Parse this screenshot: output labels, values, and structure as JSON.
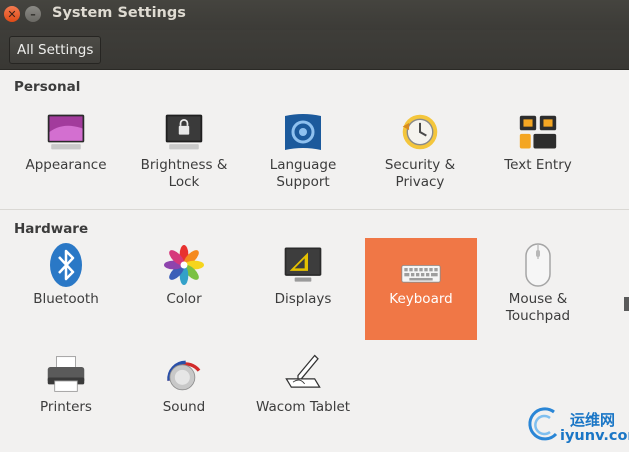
{
  "window": {
    "title": "System Settings"
  },
  "toolbar": {
    "all_settings": "All Settings"
  },
  "sections": {
    "personal": {
      "heading": "Personal",
      "items": [
        {
          "label": "Appearance",
          "icon": "appearance-icon"
        },
        {
          "label": "Brightness &\nLock",
          "icon": "brightness-lock-icon"
        },
        {
          "label": "Language\nSupport",
          "icon": "language-support-icon"
        },
        {
          "label": "Security &\nPrivacy",
          "icon": "security-privacy-icon"
        },
        {
          "label": "Text Entry",
          "icon": "text-entry-icon"
        }
      ]
    },
    "hardware": {
      "heading": "Hardware",
      "items": [
        {
          "label": "Bluetooth",
          "icon": "bluetooth-icon"
        },
        {
          "label": "Color",
          "icon": "color-icon"
        },
        {
          "label": "Displays",
          "icon": "displays-icon"
        },
        {
          "label": "Keyboard",
          "icon": "keyboard-icon",
          "selected": true
        },
        {
          "label": "Mouse &\nTouchpad",
          "icon": "mouse-icon"
        },
        {
          "label": "Printers",
          "icon": "printer-icon"
        },
        {
          "label": "Sound",
          "icon": "sound-icon"
        },
        {
          "label": "Wacom Tablet",
          "icon": "wacom-tablet-icon"
        }
      ]
    }
  },
  "watermark": {
    "cn": "运维网",
    "en": "iyunv.com"
  },
  "colors": {
    "selected": "#f07746",
    "titlebar": "#3c3b37",
    "background": "#f2f1f0"
  }
}
